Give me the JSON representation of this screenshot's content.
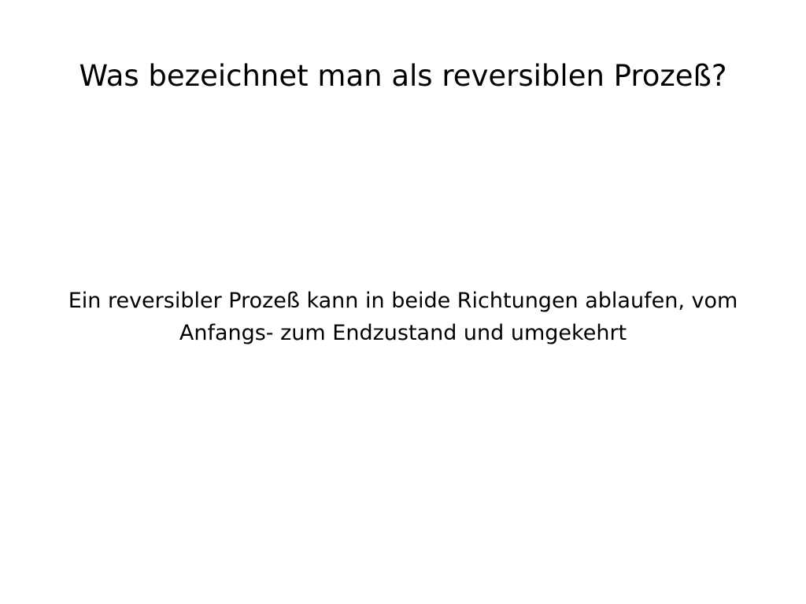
{
  "slide": {
    "question": "Was bezeichnet man als reversiblen Prozeß?",
    "answer": "Ein reversibler Prozeß kann in beide Richtungen ablaufen, vom Anfangs- zum Endzustand und umgekehrt"
  }
}
